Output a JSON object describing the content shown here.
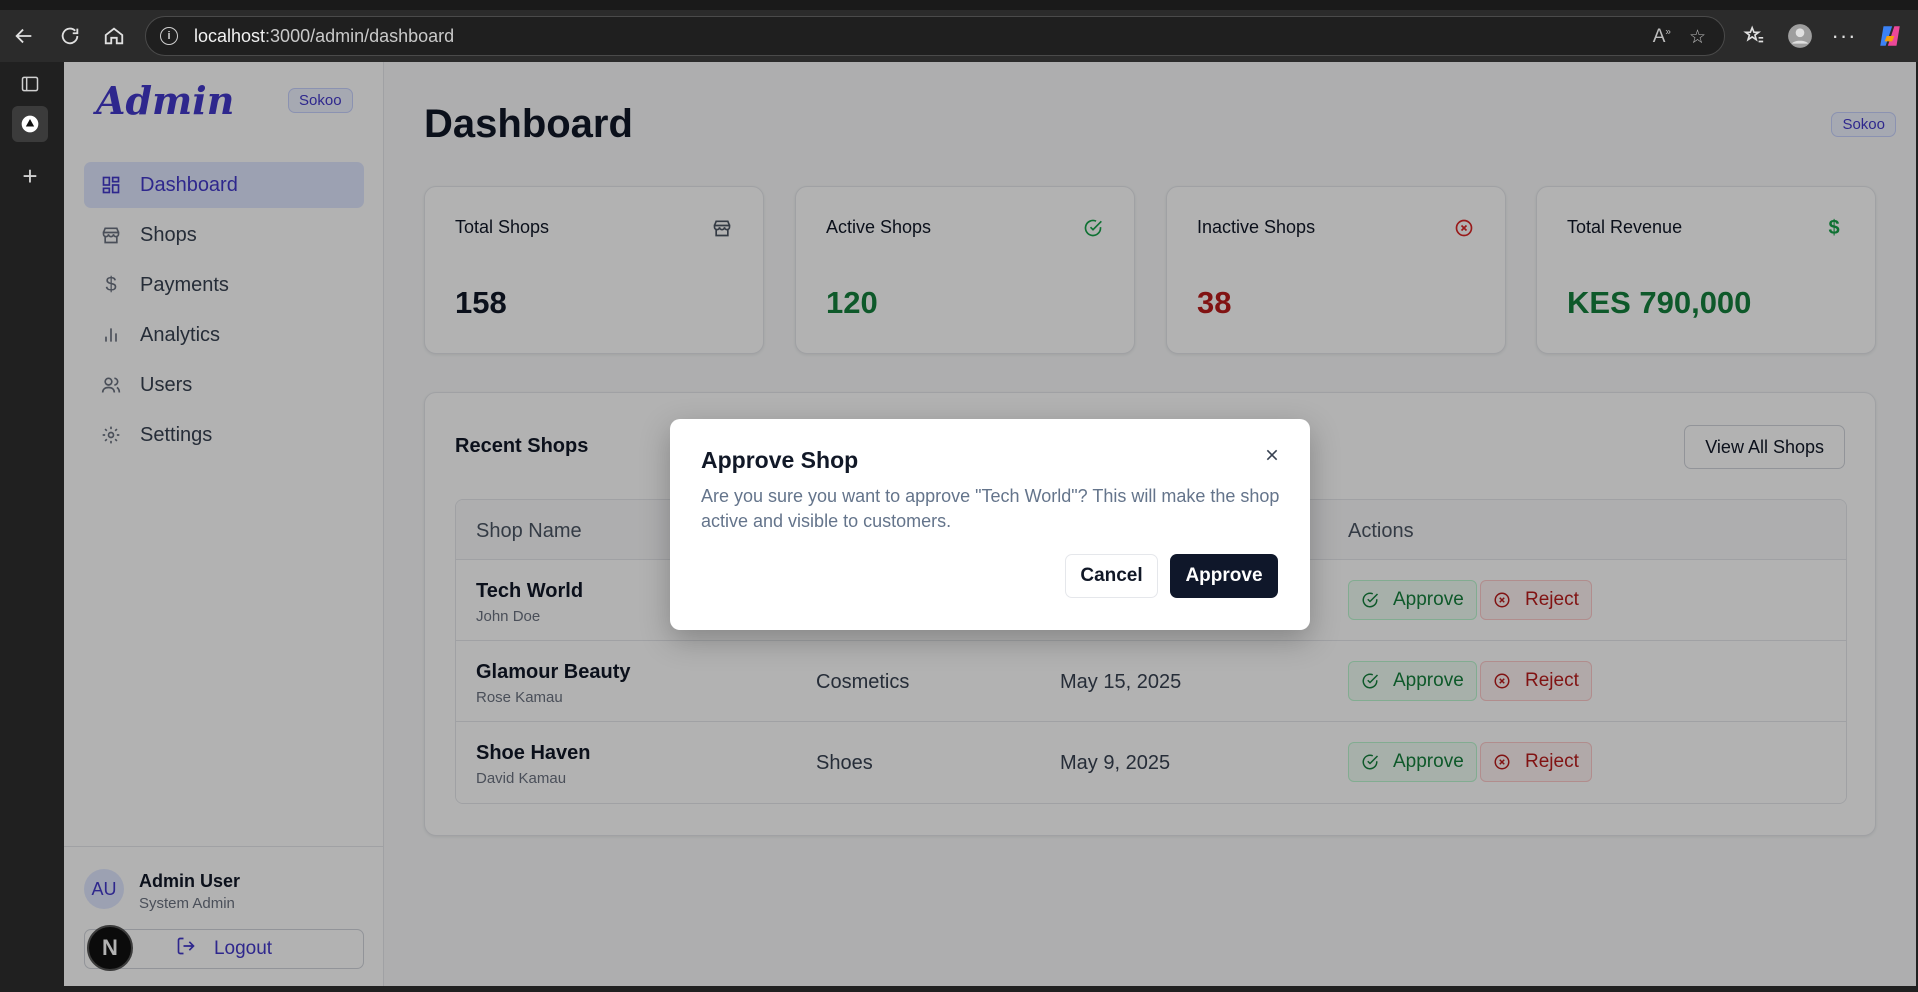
{
  "browser": {
    "url_host": "localhost",
    "url_path": ":3000/admin/dashboard",
    "icons": [
      "back-icon",
      "refresh-icon",
      "home-icon",
      "site-info-icon",
      "read-aloud-icon",
      "favorite-star-icon",
      "favorites-icon",
      "profile-icon",
      "more-icon",
      "copilot-icon"
    ]
  },
  "sidebar": {
    "logo": "Admin",
    "badge": "Sokoo",
    "items": [
      {
        "label": "Dashboard",
        "icon": "grid-icon",
        "active": true
      },
      {
        "label": "Shops",
        "icon": "store-icon"
      },
      {
        "label": "Payments",
        "icon": "dollar-icon"
      },
      {
        "label": "Analytics",
        "icon": "bar-chart-icon"
      },
      {
        "label": "Users",
        "icon": "users-icon"
      },
      {
        "label": "Settings",
        "icon": "gear-icon"
      }
    ],
    "user": {
      "initials": "AU",
      "name": "Admin User",
      "role": "System Admin"
    },
    "logout": "Logout",
    "dev_badge": "N"
  },
  "header": {
    "title": "Dashboard",
    "badge": "Sokoo"
  },
  "stats": [
    {
      "label": "Total Shops",
      "value": "158",
      "icon": "store-icon",
      "color": "#111827"
    },
    {
      "label": "Active Shops",
      "value": "120",
      "icon": "check-circle-icon",
      "color": "#15803d"
    },
    {
      "label": "Inactive Shops",
      "value": "38",
      "icon": "x-circle-icon",
      "color": "#b91c1c"
    },
    {
      "label": "Total Revenue",
      "value": "KES 790,000",
      "icon": "dollar-icon",
      "color": "#15803d"
    }
  ],
  "recent": {
    "title": "Recent Shops",
    "view_all": "View All Shops",
    "columns": [
      "Shop Name",
      "Actions"
    ],
    "rows": [
      {
        "name": "Tech World",
        "owner": "John Doe",
        "category": "",
        "date": "",
        "approve": "Approve",
        "reject": "Reject"
      },
      {
        "name": "Glamour Beauty",
        "owner": "Rose Kamau",
        "category": "Cosmetics",
        "date": "May 15, 2025",
        "approve": "Approve",
        "reject": "Reject"
      },
      {
        "name": "Shoe Haven",
        "owner": "David Kamau",
        "category": "Shoes",
        "date": "May 9, 2025",
        "approve": "Approve",
        "reject": "Reject"
      }
    ]
  },
  "modal": {
    "title": "Approve Shop",
    "body": "Are you sure you want to approve \"Tech World\"? This will make the shop active and visible to customers.",
    "cancel": "Cancel",
    "confirm": "Approve"
  },
  "colors": {
    "accent": "#4338ca",
    "success": "#15803d",
    "danger": "#b91c1c",
    "primary_button": "#0f172a"
  }
}
